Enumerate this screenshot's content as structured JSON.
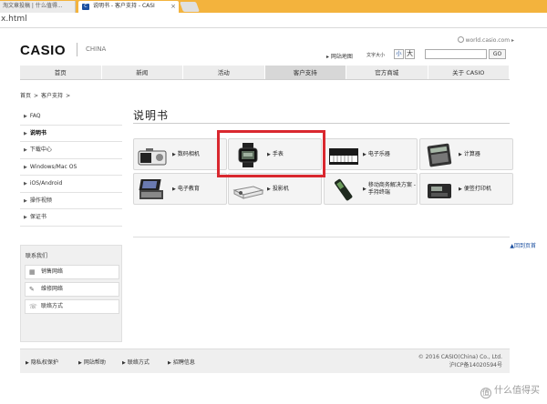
{
  "browser": {
    "tabs": [
      {
        "label": "淘文章投稿 | 什么值得..."
      },
      {
        "label": "说明书 - 客户支持 - CASI"
      }
    ],
    "url": "x.html"
  },
  "header": {
    "logo": "CASIO",
    "country": "CHINA",
    "world_link": "world.casio.com",
    "sitemap": "网站地图",
    "fontsize_label": "文字大小",
    "font_small": "小",
    "font_large": "大",
    "go": "GO"
  },
  "nav": [
    "首页",
    "新闻",
    "活动",
    "客户支持",
    "官方商城",
    "关于 CASIO"
  ],
  "nav_active": 3,
  "breadcrumb": [
    "首页",
    ">",
    "客户支持",
    ">"
  ],
  "sidebar": {
    "items": [
      "FAQ",
      "说明书",
      "下载中心",
      "Windows/Mac OS",
      "iOS/Android",
      "操作视频",
      "保证书"
    ],
    "active": 1,
    "contact_title": "联系我们",
    "contact_items": [
      "销售网络",
      "维修网络",
      "联络方式"
    ]
  },
  "main": {
    "title": "说明书",
    "cards": [
      {
        "label": "数码相机",
        "icon": "camera-icon"
      },
      {
        "label": "手表",
        "icon": "watch-icon"
      },
      {
        "label": "电子乐器",
        "icon": "keyboard-icon"
      },
      {
        "label": "计算器",
        "icon": "calculator-icon"
      },
      {
        "label": "电子教育",
        "icon": "e-dictionary-icon"
      },
      {
        "label": "投影机",
        "icon": "projector-icon"
      },
      {
        "label": "移动商务解决方案 - 手持终端",
        "icon": "handheld-terminal-icon"
      },
      {
        "label": "便签打印机",
        "icon": "label-printer-icon"
      }
    ],
    "top_link": "▲回到页首"
  },
  "footer": {
    "links": [
      "隐私权保护",
      "网站帮助",
      "联络方式",
      "招聘信息"
    ],
    "copyright": "© 2016 CASIO(China) Co., Ltd.",
    "icp": "沪ICP备14020594号"
  },
  "watermark": "什么值得买",
  "colors": {
    "tabbar": "#f3b33d",
    "highlight": "#d9282f",
    "nav": "#ececec"
  }
}
